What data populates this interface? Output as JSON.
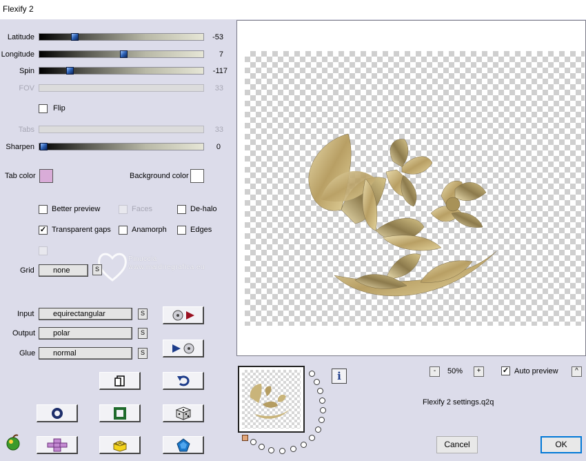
{
  "window": {
    "title": "Flexify 2"
  },
  "sliders": [
    {
      "id": "latitude",
      "label": "Latitude",
      "value": "-53",
      "fraction": 0.22,
      "enabled": true
    },
    {
      "id": "longitude",
      "label": "Longitude",
      "value": "7",
      "fraction": 0.51,
      "enabled": true
    },
    {
      "id": "spin",
      "label": "Spin",
      "value": "-117",
      "fraction": 0.18,
      "enabled": true
    },
    {
      "id": "fov",
      "label": "FOV",
      "value": "33",
      "fraction": null,
      "enabled": false
    },
    {
      "id": "tabs",
      "label": "Tabs",
      "value": "33",
      "fraction": null,
      "enabled": false
    },
    {
      "id": "sharpen",
      "label": "Sharpen",
      "value": "0",
      "fraction": 0.0,
      "enabled": true
    }
  ],
  "flip": {
    "label": "Flip",
    "checked": false
  },
  "colors": {
    "tab_label": "Tab color",
    "tab_color": "#d9acd8",
    "background_label": "Background color",
    "background_color": "#ffffff"
  },
  "options": {
    "better_preview": {
      "label": "Better preview",
      "checked": false,
      "enabled": true
    },
    "faces": {
      "label": "Faces",
      "checked": false,
      "enabled": false
    },
    "de_halo": {
      "label": "De-halo",
      "checked": false,
      "enabled": true
    },
    "transparent_gaps": {
      "label": "Transparent gaps",
      "checked": true,
      "enabled": true
    },
    "anamorph": {
      "label": "Anamorph",
      "checked": false,
      "enabled": true
    },
    "edges": {
      "label": "Edges",
      "checked": false,
      "enabled": true
    }
  },
  "grid": {
    "label": "Grid",
    "value": "none",
    "s_label": "S"
  },
  "mapping": {
    "input": {
      "label": "Input",
      "value": "equirectangular",
      "s_label": "S"
    },
    "output": {
      "label": "Output",
      "value": "polar",
      "s_label": "S"
    },
    "glue": {
      "label": "Glue",
      "value": "normal",
      "s_label": "S"
    }
  },
  "watermark": {
    "line1": "Pinuccia",
    "line2": "www.maidiregrafica.eu"
  },
  "preview": {
    "zoom": "50%",
    "zoom_minus": "-",
    "zoom_plus": "+",
    "auto_preview_label": "Auto preview",
    "auto_preview_checked": true,
    "caret_label": "^",
    "settings_file": "Flexify 2 settings.q2q",
    "info_label": "i"
  },
  "buttons": {
    "cancel": "Cancel",
    "ok": "OK"
  },
  "theme": {
    "panel_bg": "#dcdcea",
    "petal_light": "#e3d6a4",
    "petal_mid": "#c0ab72",
    "petal_dark": "#7a6a44",
    "accent_blue": "#2b5fb3"
  }
}
